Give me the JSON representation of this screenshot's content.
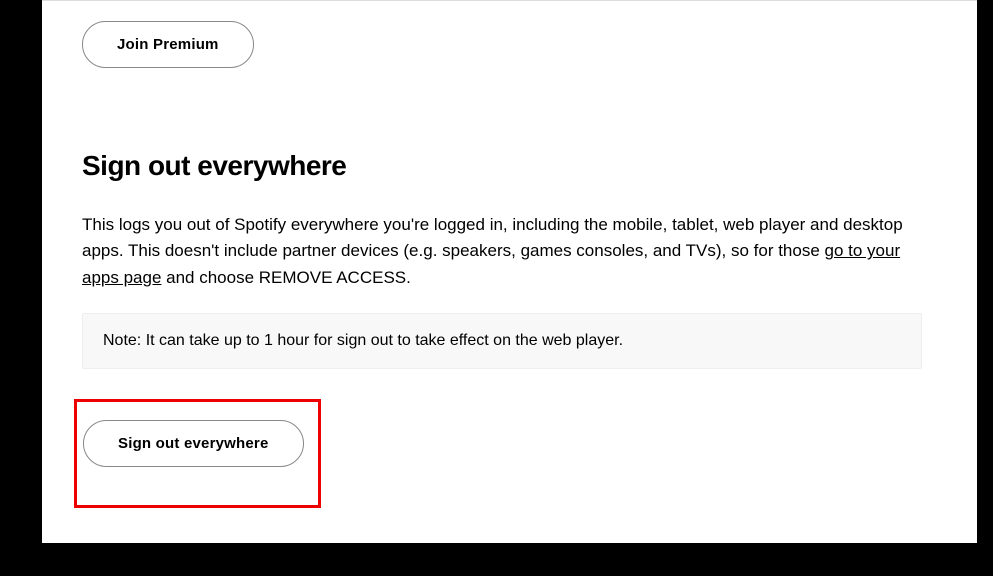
{
  "buttons": {
    "join_premium": "Join Premium",
    "sign_out_everywhere": "Sign out everywhere"
  },
  "section": {
    "heading": "Sign out everywhere",
    "description_part1": "This logs you out of Spotify everywhere you're logged in, including the mobile, tablet, web player and desktop apps. This doesn't include partner devices (e.g. speakers, games consoles, and TVs), so for those ",
    "link_text": "go to your apps page",
    "description_part2": " and choose REMOVE ACCESS.",
    "note": "Note: It can take up to 1 hour for sign out to take effect on the web player."
  }
}
